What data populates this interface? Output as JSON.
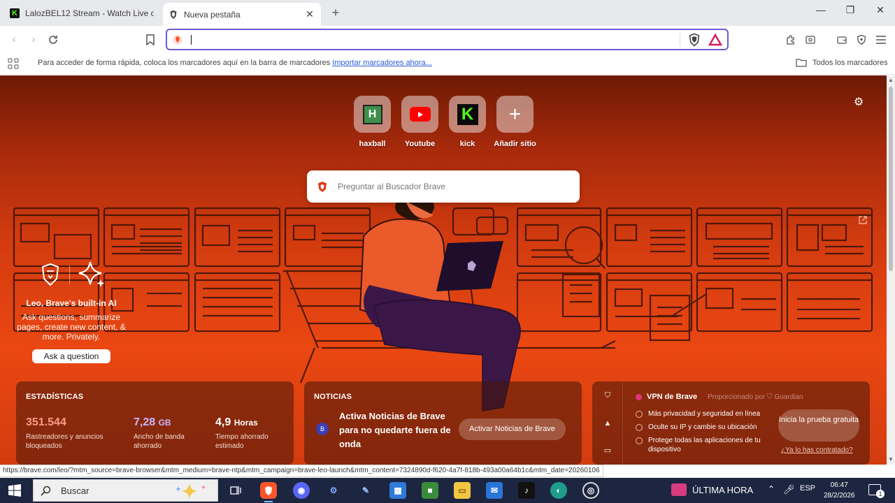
{
  "tabs": [
    {
      "title": "LalozBEL12 Stream - Watch Live on Kick",
      "active": false
    },
    {
      "title": "Nueva pestaña",
      "active": true
    }
  ],
  "toolbar": {
    "omnibox_value": "",
    "omnibox_placeholder": ""
  },
  "bookmarks_bar": {
    "hint": "Para acceder de forma rápida, coloca los marcadores aquí en la barra de marcadores",
    "import_link": "Importar marcadores ahora...",
    "all_bookmarks": "Todos los marcadores"
  },
  "ntp": {
    "top_sites": [
      {
        "label": "haxball",
        "icon": "haxball-icon"
      },
      {
        "label": "Youtube",
        "icon": "youtube-icon"
      },
      {
        "label": "kick",
        "icon": "kick-icon"
      },
      {
        "label": "Añadir sitio",
        "icon": "plus-icon"
      }
    ],
    "search_placeholder": "Preguntar al Buscador Brave",
    "leo": {
      "title": "Leo, Brave's built-in AI",
      "description": "Ask questions, summarize pages, create new content, & more. Privately.",
      "button": "Ask a question"
    },
    "stats": {
      "header": "ESTADÍSTICAS",
      "items": [
        {
          "value": "351.544",
          "unit": "",
          "caption": "Rastreadores y anuncios bloqueados",
          "color": "#ff9a8a"
        },
        {
          "value": "7,28",
          "unit": "GB",
          "caption": "Ancho de banda ahorrado",
          "color": "#c9b6ff"
        },
        {
          "value": "4,9",
          "unit": "Horas",
          "caption": "Tiempo ahorrado estimado",
          "color": "#ffffff"
        }
      ]
    },
    "news": {
      "header": "NOTICIAS",
      "headline": "Activa Noticias de Brave para no quedarte fuera de onda",
      "button": "Activar Noticias de Brave"
    },
    "vpn": {
      "title": "VPN de Brave",
      "powered_by": "Proporcionado por",
      "powered_brand": "Guardian",
      "features": [
        "Más privacidad y seguridad en línea",
        "Oculte su IP y cambie su ubicación",
        "Protege todas las aplicaciones de tu dispositivo"
      ],
      "button": "Inicia la prueba gratuita",
      "link": "¿Ya lo has contratado?"
    }
  },
  "status_url": "https://brave.com/leo/?mtm_source=brave-browser&mtm_medium=brave-ntp&mtm_campaign=brave-leo-launch&mtm_content=7324890d-f620-4a7f-818b-493a00a64b1c&mtm_date=20260106",
  "taskbar": {
    "search_label": "Buscar",
    "news_label": "ÚLTIMA HORA",
    "lang": "ESP",
    "time": "06:47",
    "date": "28/2/2026",
    "notification_count": "1"
  },
  "colors": {
    "accent": "#7158d6",
    "brave_orange": "#fb542b",
    "ntp_bg": "#e14510"
  }
}
